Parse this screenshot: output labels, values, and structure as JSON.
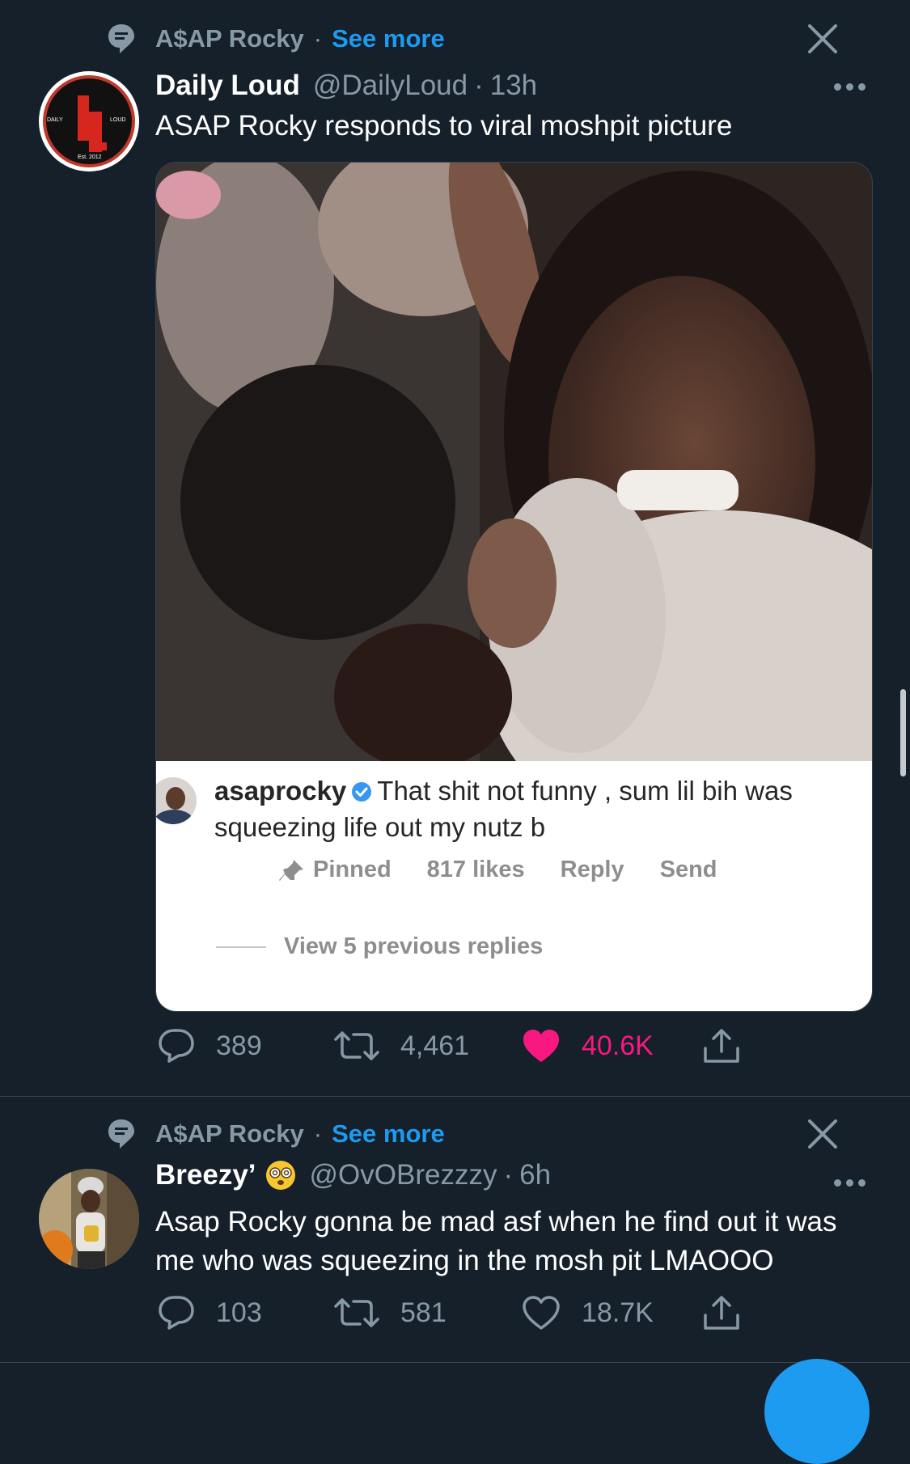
{
  "tweets": [
    {
      "topic": {
        "name": "A$AP Rocky",
        "see_more": "See more"
      },
      "author": {
        "name": "Daily Loud",
        "handle": "@DailyLoud",
        "time": "13h"
      },
      "text": "ASAP Rocky responds to viral moshpit picture",
      "avatar_text": {
        "left": "DAILY",
        "right": "LOUD",
        "letters": "DL",
        "est": "Est. 2012"
      },
      "media": {
        "comment": {
          "user": "asaprocky",
          "text": "That shit not funny , sum lil bih was squeezing life out my nutz b",
          "pinned": "Pinned",
          "likes": "817 likes",
          "reply": "Reply",
          "send": "Send",
          "view_replies": "View 5 previous replies"
        }
      },
      "stats": {
        "replies": "389",
        "retweets": "4,461",
        "likes": "40.6K",
        "liked": true
      }
    },
    {
      "topic": {
        "name": "A$AP Rocky",
        "see_more": "See more"
      },
      "author": {
        "name": "Breezy’",
        "handle": "@OvOBrezzzy",
        "time": "6h"
      },
      "text": "Asap Rocky gonna be mad asf when he find out it was me who was squeezing in the mosh pit LMAOOO",
      "stats": {
        "replies": "103",
        "retweets": "581",
        "likes": "18.7K",
        "liked": false
      }
    }
  ],
  "colors": {
    "background": "#15202b",
    "accent": "#1d9bf0",
    "like": "#f91880",
    "muted": "#8899a6"
  },
  "separator": "·"
}
